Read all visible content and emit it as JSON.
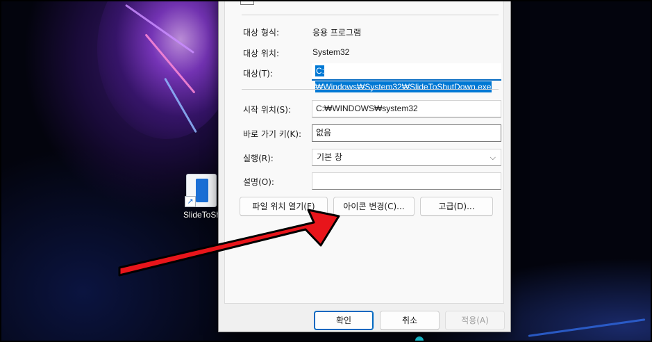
{
  "shortcut": {
    "label": "SlideToShutDown.exe"
  },
  "dialog": {
    "rows": {
      "target_type_label": "대상 형식:",
      "target_type_value": "응용 프로그램",
      "target_location_label": "대상 위치:",
      "target_location_value": "System32",
      "target_label": "대상(T):",
      "target_value": "C:₩Windows₩System32₩SlideToShutDown.exe",
      "start_in_label": "시작 위치(S):",
      "start_in_value": "C:₩WINDOWS₩system32",
      "shortcut_key_label": "바로 가기 키(K):",
      "shortcut_key_value": "없음",
      "run_label": "실행(R):",
      "run_value": "기본 창",
      "comment_label": "설명(O):",
      "comment_value": ""
    },
    "buttons": {
      "open_file_location": "파일 위치 열기(F)",
      "change_icon": "아이콘 변경(C)...",
      "advanced": "고급(D)...",
      "ok": "확인",
      "cancel": "취소",
      "apply": "적용(A)"
    }
  },
  "colors": {
    "accent": "#0067c0",
    "selection": "#0078d4",
    "annotation_arrow": "#e8151b"
  }
}
